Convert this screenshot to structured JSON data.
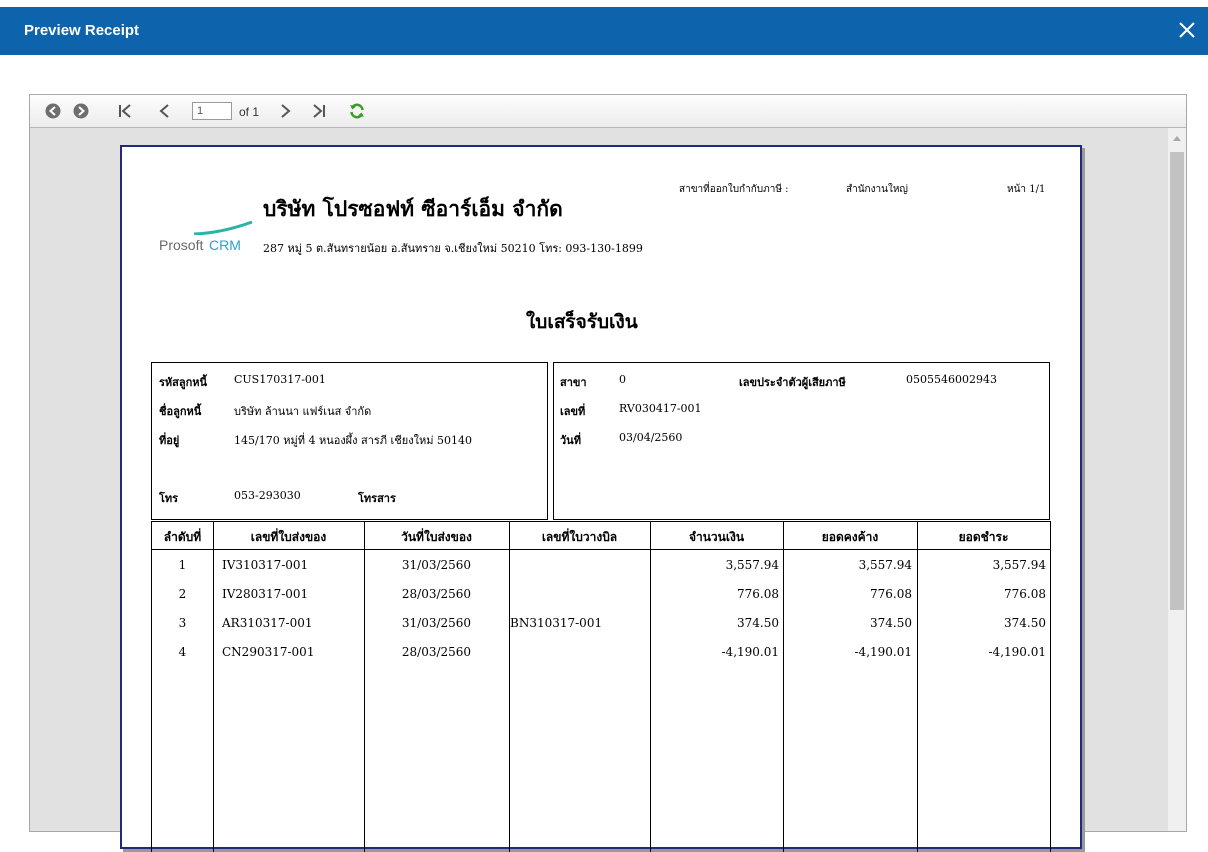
{
  "window": {
    "title": "Preview Receipt"
  },
  "toolbar": {
    "page_value": "1",
    "page_of": "of 1"
  },
  "receipt": {
    "branch_issue_label": "สาขาที่ออกใบกำกับภาษี :",
    "branch_issue_value": "สำนักงานใหญ่",
    "page_label": "หน้า 1/1",
    "logo_prosoft": "Prosoft",
    "logo_crm": "CRM",
    "company_name": "บริษัท โปรซอฟท์ ซีอาร์เอ็ม จำกัด",
    "company_address": "287 หมู่ 5 ต.สันทรายน้อย อ.สันทราย จ.เชียงใหม่ 50210 โทร: 093-130-1899",
    "doc_title": "ใบเสร็จรับเงิน",
    "customer": {
      "code_label": "รหัสลูกหนี้",
      "code_value": "CUS170317-001",
      "name_label": "ชื่อลูกหนี้",
      "name_value": "บริษัท ล้านนา แฟร์เนส จำกัด",
      "address_label": "ที่อยู่",
      "address_value": "145/170 หมู่ที่ 4 หนองผึ้ง สารภี เชียงใหม่ 50140",
      "tel_label": "โทร",
      "tel_value": "053-293030",
      "fax_label": "โทรสาร",
      "fax_value": ""
    },
    "doc_info": {
      "branch_label": "สาขา",
      "branch_value": "0",
      "taxid_label": "เลขประจำตัวผู้เสียภาษี",
      "taxid_value": "0505546002943",
      "no_label": "เลขที่",
      "no_value": "RV030417-001",
      "date_label": "วันที่",
      "date_value": "03/04/2560"
    },
    "table": {
      "headers": [
        "ลำดับที่",
        "เลขที่ใบส่งของ",
        "วันที่ใบส่งของ",
        "เลขที่ใบวางบิล",
        "จำนวนเงิน",
        "ยอดคงค้าง",
        "ยอดชำระ"
      ],
      "rows": [
        {
          "no": "1",
          "invoice": "IV310317-001",
          "date": "31/03/2560",
          "billing": "",
          "amount": "3,557.94",
          "outstanding": "3,557.94",
          "paid": "3,557.94"
        },
        {
          "no": "2",
          "invoice": "IV280317-001",
          "date": "28/03/2560",
          "billing": "",
          "amount": "776.08",
          "outstanding": "776.08",
          "paid": "776.08"
        },
        {
          "no": "3",
          "invoice": "AR310317-001",
          "date": "31/03/2560",
          "billing": "BN310317-001",
          "amount": "374.50",
          "outstanding": "374.50",
          "paid": "374.50"
        },
        {
          "no": "4",
          "invoice": "CN290317-001",
          "date": "28/03/2560",
          "billing": "",
          "amount": "-4,190.01",
          "outstanding": "-4,190.01",
          "paid": "-4,190.01"
        }
      ]
    }
  }
}
